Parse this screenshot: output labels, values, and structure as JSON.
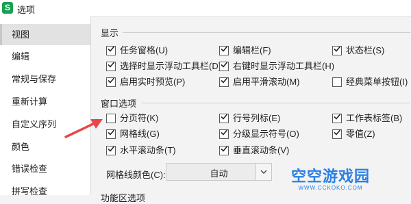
{
  "window": {
    "icon_letter": "S",
    "title": "选项"
  },
  "sidebar": {
    "items": [
      {
        "label": "视图"
      },
      {
        "label": "编辑"
      },
      {
        "label": "常规与保存"
      },
      {
        "label": "重新计算"
      },
      {
        "label": "自定义序列"
      },
      {
        "label": "颜色"
      },
      {
        "label": "错误检查"
      },
      {
        "label": "拼写检查"
      }
    ]
  },
  "display": {
    "title": "显示",
    "options": [
      {
        "label": "任务窗格(U)",
        "checked": true
      },
      {
        "label": "编辑栏(F)",
        "checked": true
      },
      {
        "label": "状态栏(S)",
        "checked": true
      },
      {
        "label": "选择时显示浮动工具栏(D)",
        "checked": true
      },
      {
        "label": "右键时显示浮动工具栏(H)",
        "checked": true
      },
      {
        "label": "启用实时预览(P)",
        "checked": true
      },
      {
        "label": "启用平滑滚动(M)",
        "checked": true
      },
      {
        "label": "经典菜单按钮(I)",
        "checked": false
      }
    ]
  },
  "window_options": {
    "title": "窗口选项",
    "options": [
      {
        "label": "分页符(K)",
        "checked": false
      },
      {
        "label": "行号列标(E)",
        "checked": true
      },
      {
        "label": "工作表标签(B)",
        "checked": true
      },
      {
        "label": "网格线(G)",
        "checked": true
      },
      {
        "label": "分级显示符号(O)",
        "checked": true
      },
      {
        "label": "零值(Z)",
        "checked": true
      },
      {
        "label": "水平滚动条(T)",
        "checked": true
      },
      {
        "label": "垂直滚动条(V)",
        "checked": true
      }
    ],
    "gridline_color_label": "网格线颜色(C):",
    "gridline_color_value": "自动"
  },
  "next_section_partial": "功能区选项",
  "watermark": {
    "title": "空空游戏园",
    "url": "WWW.CCKOKO.COM"
  },
  "colors": {
    "accent": "#1aa053",
    "check": "#222222",
    "annotation_arrow": "#e8474a"
  }
}
